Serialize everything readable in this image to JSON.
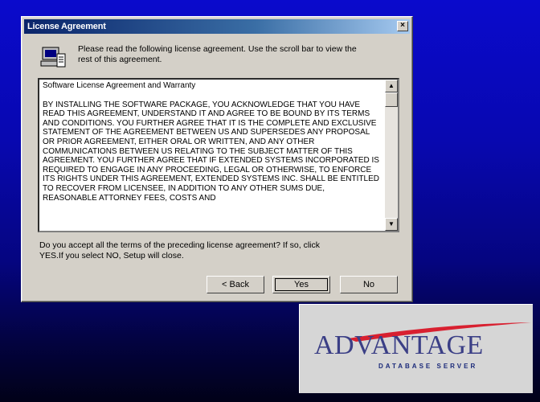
{
  "dialog": {
    "title": "License Agreement",
    "close_label": "×",
    "header_text": "Please read the following license agreement. Use the scroll bar to view the rest of this agreement.",
    "license_heading": "Software License Agreement and Warranty",
    "license_body": "BY INSTALLING THE SOFTWARE PACKAGE, YOU ACKNOWLEDGE THAT YOU HAVE READ THIS AGREEMENT, UNDERSTAND IT AND AGREE TO BE BOUND BY ITS TERMS AND CONDITIONS.  YOU FURTHER AGREE THAT IT IS THE COMPLETE AND EXCLUSIVE STATEMENT OF THE AGREEMENT BETWEEN US AND SUPERSEDES ANY PROPOSAL OR PRIOR AGREEMENT, EITHER ORAL OR WRITTEN, AND ANY OTHER COMMUNICATIONS BETWEEN US RELATING TO THE SUBJECT MATTER OF THIS AGREEMENT.  YOU FURTHER AGREE THAT IF EXTENDED SYSTEMS INCORPORATED IS REQUIRED TO ENGAGE IN ANY PROCEEDING, LEGAL OR OTHERWISE, TO ENFORCE ITS RIGHTS UNDER THIS AGREEMENT, EXTENDED SYSTEMS INC. SHALL BE ENTITLED TO RECOVER FROM LICENSEE, IN ADDITION TO ANY OTHER SUMS DUE, REASONABLE ATTORNEY FEES, COSTS AND",
    "question": "Do you accept all the terms of the preceding license agreement? If so, click YES.If you select NO, Setup will close.",
    "buttons": {
      "back": "< Back",
      "yes": "Yes",
      "no": "No"
    },
    "scroll_up": "▲",
    "scroll_down": "▼"
  },
  "logo": {
    "brand": "ADVANTAGE",
    "tagline": "DATABASE SERVER",
    "colors": {
      "brand": "#3b3f86",
      "swoosh": "#d82030"
    }
  },
  "colors": {
    "titlebar_start": "#0a246a",
    "titlebar_end": "#a6caf0",
    "desktop": "#0808b0"
  }
}
